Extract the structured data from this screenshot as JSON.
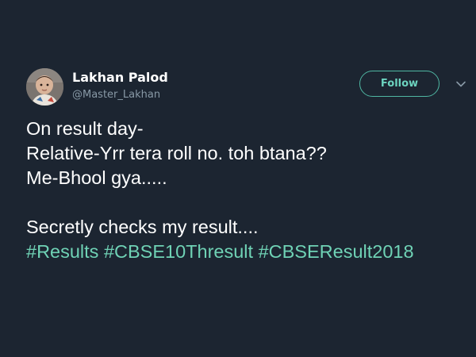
{
  "author": {
    "display_name": "Lakhan Palod",
    "handle": "@Master_Lakhan"
  },
  "follow_label": "Follow",
  "tweet": {
    "line1": "On result day-",
    "line2": "Relative-Yrr tera roll no. toh btana??",
    "line3": "Me-Bhool gya.....",
    "line4": "Secretly checks my result....",
    "hashtags": [
      "#Results",
      "#CBSE10Thresult",
      "#CBSEResult2018"
    ]
  },
  "colors": {
    "background": "#1c2531",
    "accent": "#6fd2b5",
    "secondary_text": "#8899a6"
  },
  "icons": {
    "menu": "chevron-down-icon"
  }
}
